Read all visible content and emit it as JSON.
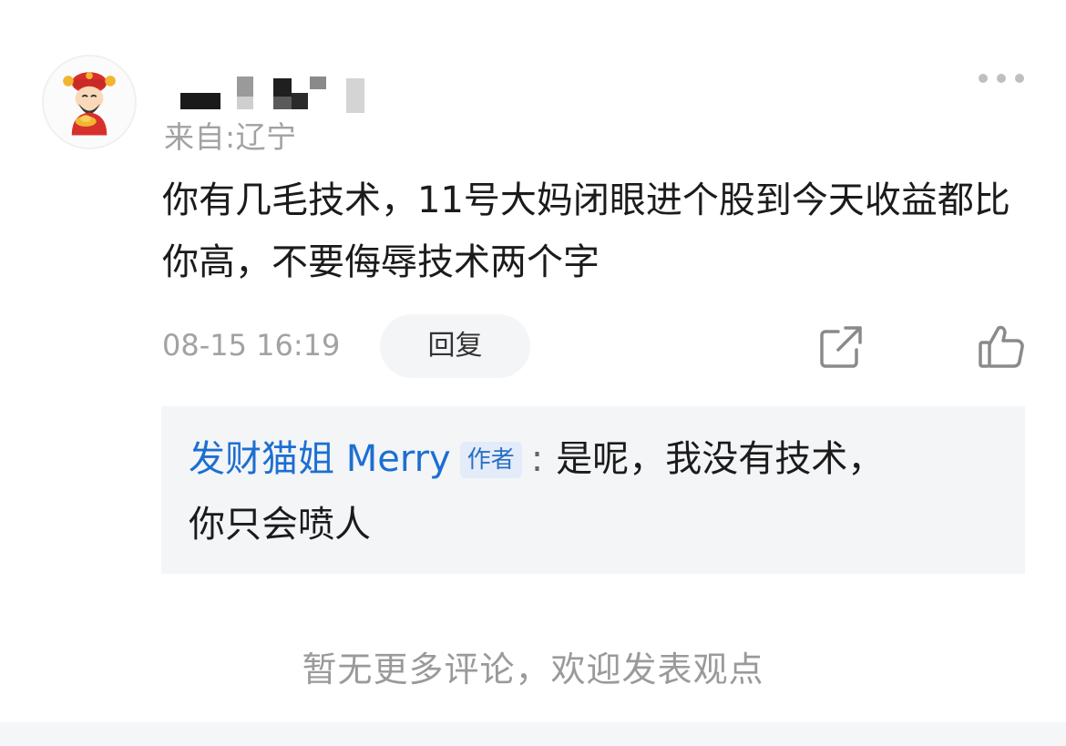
{
  "comment": {
    "location": "来自:辽宁",
    "text": "你有几毛技术，11号大妈闭眼进个股到今天收益都比你高，不要侮辱技术两个字",
    "timestamp": "08-15 16:19",
    "reply_label": "回复"
  },
  "reply": {
    "author": "发财猫姐 Merry",
    "badge": "作者",
    "colon": ":",
    "text_line1": "是呢，我没有技术，",
    "text_line2": "你只会喷人"
  },
  "footer": {
    "no_more_text": "暂无更多评论，欢迎发表观点"
  },
  "icons": {
    "avatar": "god-of-wealth-avatar",
    "more": "more-dots-icon",
    "share": "share-icon",
    "like": "thumbs-up-icon"
  },
  "colors": {
    "author_link": "#1d6fd1",
    "muted_text": "#a2a2a2",
    "reply_background": "#f4f5f7"
  }
}
